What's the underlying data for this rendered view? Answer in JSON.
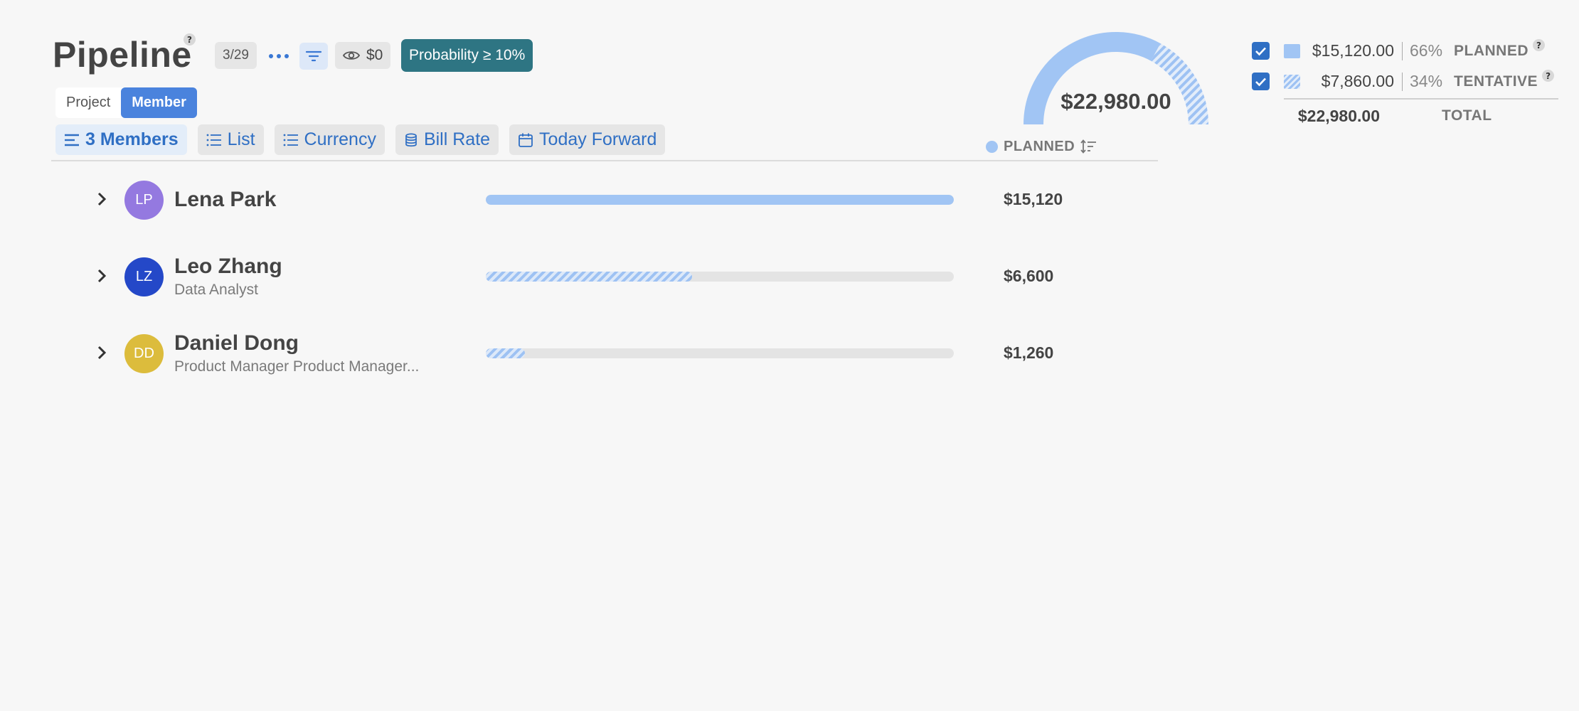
{
  "header": {
    "title": "Pipeline",
    "help": "?",
    "count_badge": "3/29",
    "eye_value": "$0",
    "probability_filter": "Probability ≥ 10%"
  },
  "view_toggle": {
    "options": [
      "Project",
      "Member"
    ],
    "active": "Member"
  },
  "chips": {
    "members": "3 Members",
    "list": "List",
    "currency": "Currency",
    "bill_rate": "Bill Rate",
    "date_range": "Today Forward"
  },
  "column_header": {
    "planned": "PLANNED"
  },
  "rows": [
    {
      "initials": "LP",
      "name": "Lena Park",
      "subtitle": "",
      "amount": "$15,120",
      "fill_fraction": 1.0,
      "pattern": "solid",
      "avatar_color": "#9479e0"
    },
    {
      "initials": "LZ",
      "name": "Leo Zhang",
      "subtitle": "Data Analyst",
      "amount": "$6,600",
      "fill_fraction": 0.44,
      "pattern": "hatched",
      "avatar_color": "#2448c8"
    },
    {
      "initials": "DD",
      "name": "Daniel Dong",
      "subtitle": "Product Manager Product Manager...",
      "amount": "$1,260",
      "fill_fraction": 0.083,
      "pattern": "hatched",
      "avatar_color": "#dcbc3c"
    }
  ],
  "gauge": {
    "total": "$22,980.00",
    "planned_fraction": 0.66,
    "tentative_fraction": 0.34
  },
  "legend": {
    "items": [
      {
        "amount": "$15,120.00",
        "percent": "66%",
        "label": "PLANNED",
        "checked": true,
        "pattern": "solid"
      },
      {
        "amount": "$7,860.00",
        "percent": "34%",
        "label": "TENTATIVE",
        "checked": true,
        "pattern": "hatched"
      }
    ],
    "total_amount": "$22,980.00",
    "total_label": "TOTAL"
  },
  "colors": {
    "accent": "#4a83dd",
    "link": "#2f6fc4",
    "teal": "#2e7583",
    "planned": "#a1c5f4"
  }
}
